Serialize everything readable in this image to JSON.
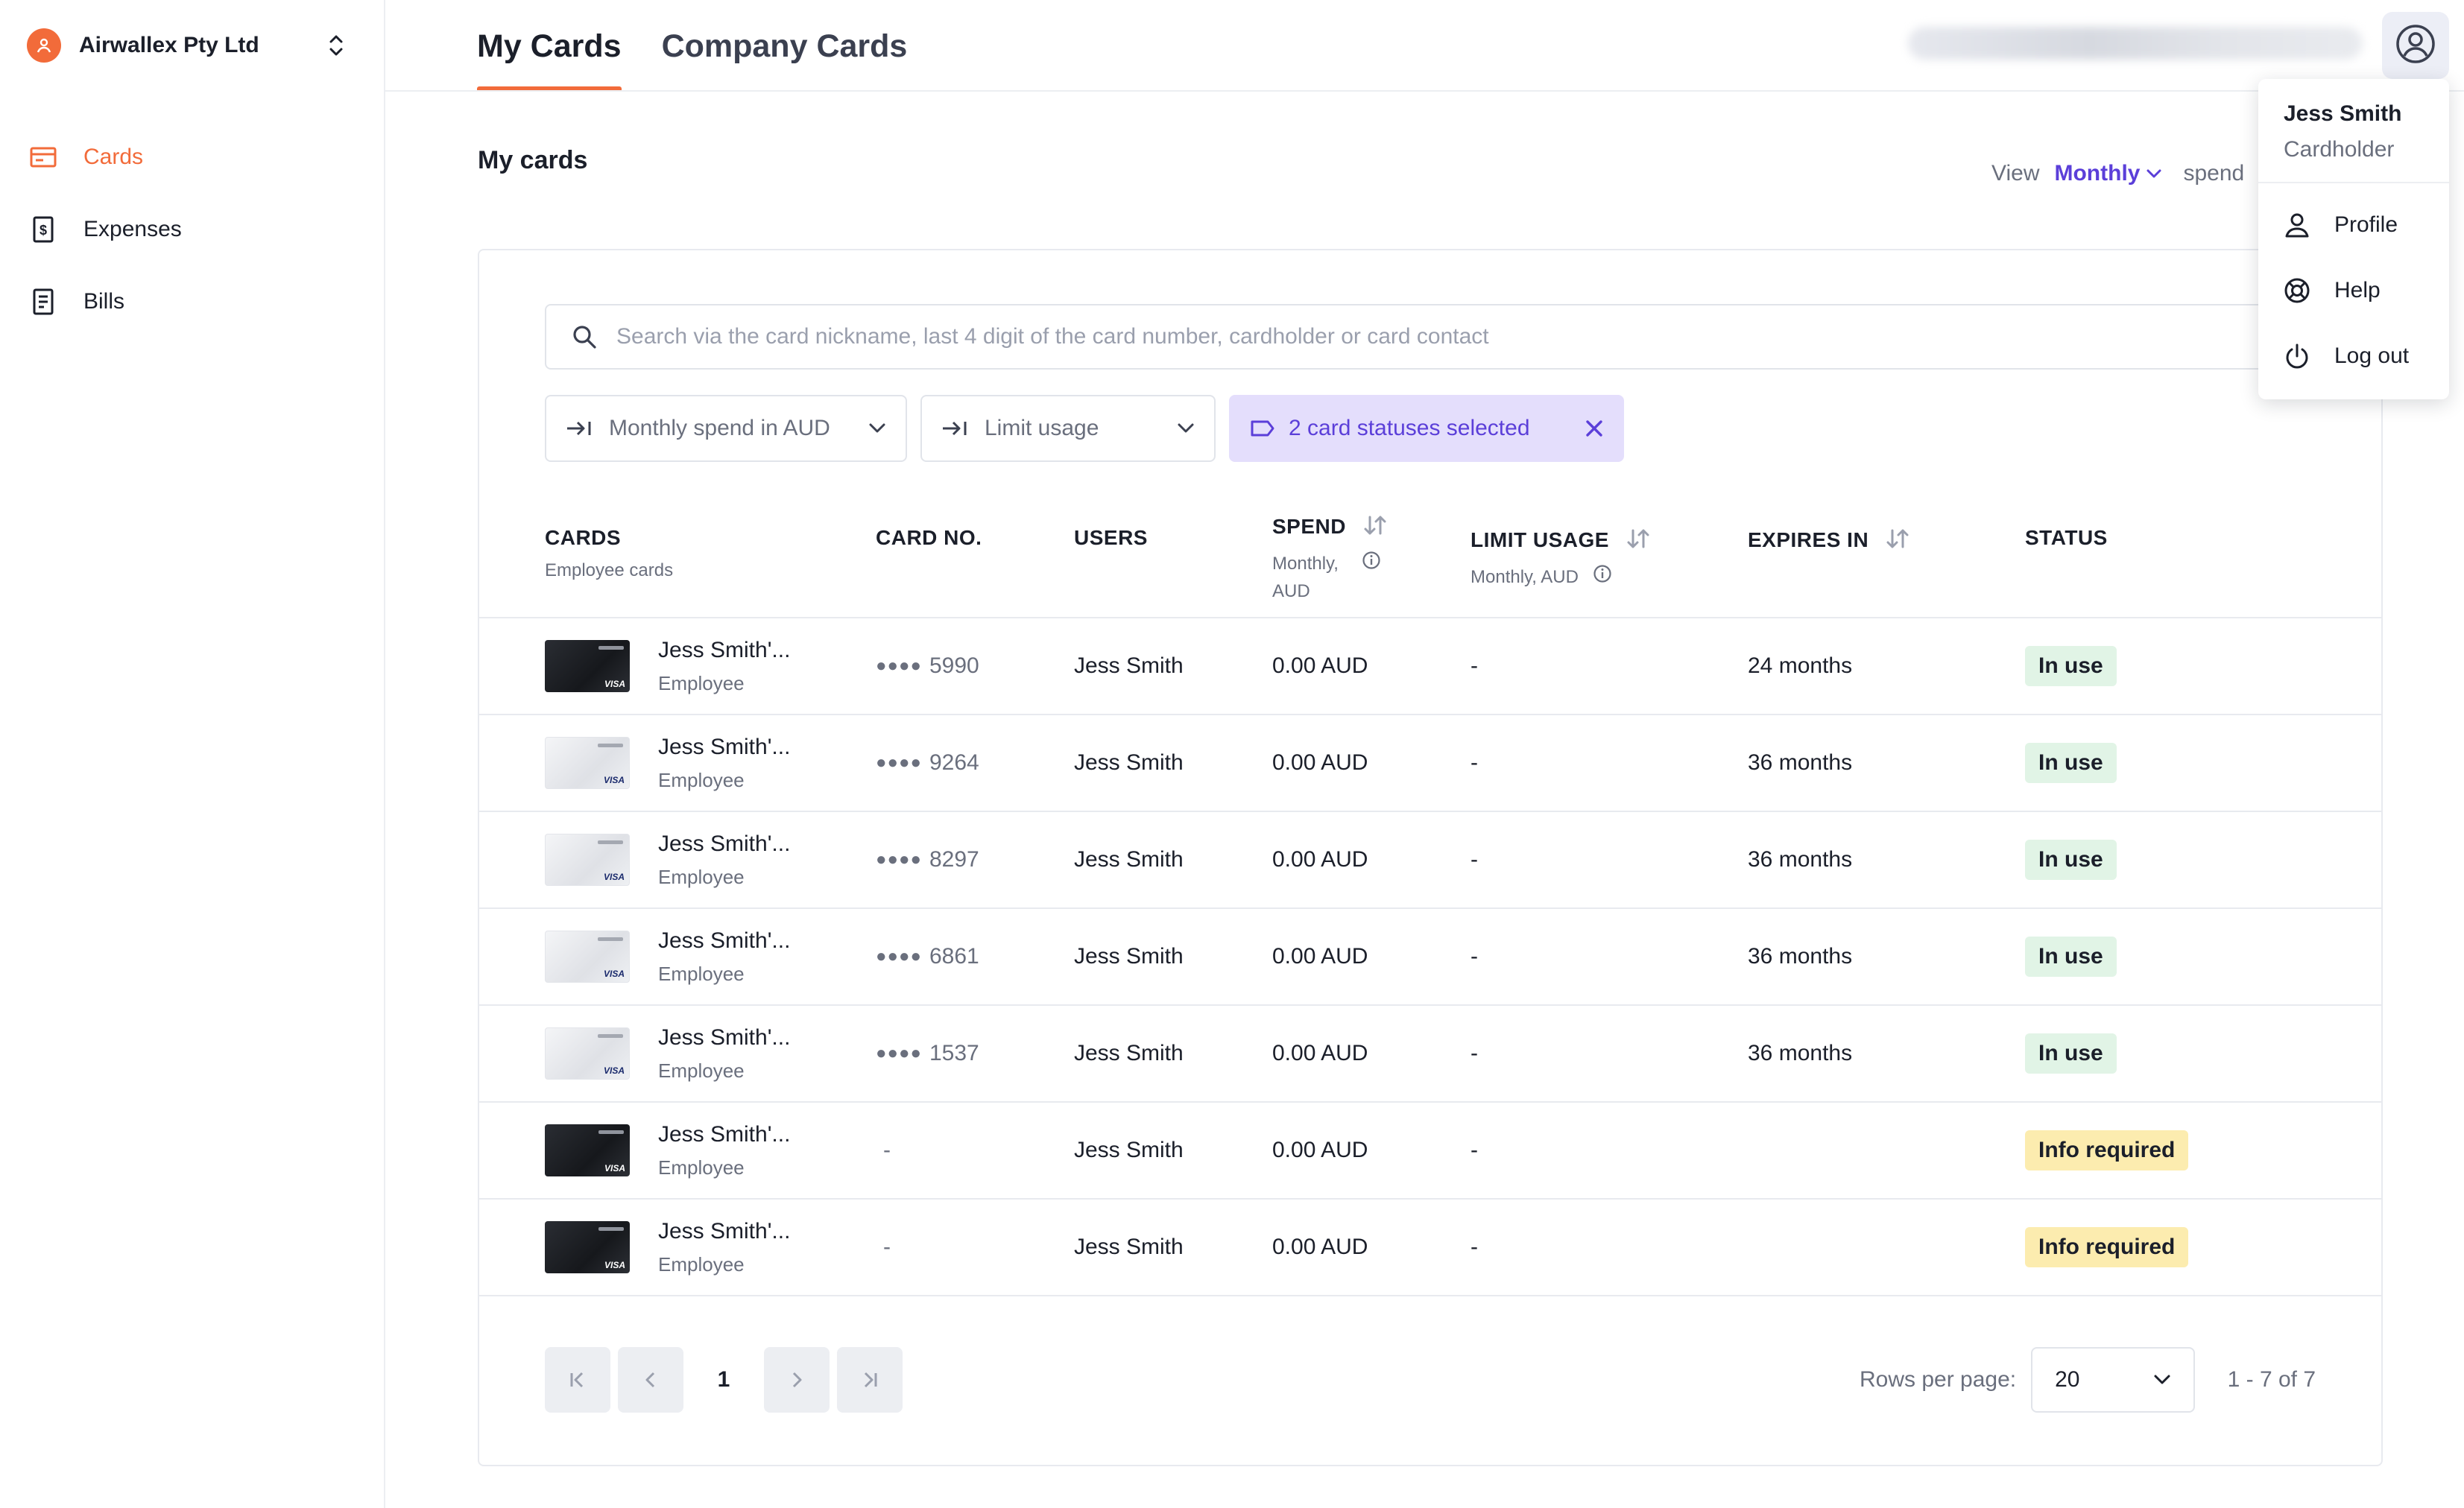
{
  "org": {
    "name": "Airwallex Pty Ltd"
  },
  "sidebar": {
    "items": [
      {
        "label": "Cards",
        "icon": "card-icon",
        "active": true
      },
      {
        "label": "Expenses",
        "icon": "receipt-icon",
        "active": false
      },
      {
        "label": "Bills",
        "icon": "document-icon",
        "active": false
      }
    ]
  },
  "tabs": [
    {
      "label": "My Cards",
      "active": true
    },
    {
      "label": "Company Cards",
      "active": false
    }
  ],
  "section": {
    "title": "My cards",
    "view_label": "View",
    "view_value": "Monthly",
    "view_suffix": "spend"
  },
  "search": {
    "placeholder": "Search via the card nickname, last 4 digit of the card number, cardholder or card contact",
    "value": ""
  },
  "filters": {
    "spend": "Monthly spend in AUD",
    "limit": "Limit usage",
    "status": "2 card statuses selected"
  },
  "table": {
    "headers": {
      "cards": "CARDS",
      "cards_sub": "Employee cards",
      "card_no": "CARD NO.",
      "users": "USERS",
      "spend": "SPEND",
      "spend_sub1": "Monthly,",
      "spend_sub2": "AUD",
      "limit": "LIMIT USAGE",
      "limit_sub": "Monthly, AUD",
      "expires": "EXPIRES IN",
      "status": "STATUS"
    },
    "rows": [
      {
        "name": "Jess Smith'...",
        "role": "Employee",
        "card_style": "dark",
        "card_no_mask": "●●●●",
        "card_no_last4": "5990",
        "user": "Jess Smith",
        "spend": "0.00 AUD",
        "limit": "-",
        "expires": "24 months",
        "status": "In use",
        "status_type": "inuse"
      },
      {
        "name": "Jess Smith'...",
        "role": "Employee",
        "card_style": "light",
        "card_no_mask": "●●●●",
        "card_no_last4": "9264",
        "user": "Jess Smith",
        "spend": "0.00 AUD",
        "limit": "-",
        "expires": "36 months",
        "status": "In use",
        "status_type": "inuse"
      },
      {
        "name": "Jess Smith'...",
        "role": "Employee",
        "card_style": "light",
        "card_no_mask": "●●●●",
        "card_no_last4": "8297",
        "user": "Jess Smith",
        "spend": "0.00 AUD",
        "limit": "-",
        "expires": "36 months",
        "status": "In use",
        "status_type": "inuse"
      },
      {
        "name": "Jess Smith'...",
        "role": "Employee",
        "card_style": "light",
        "card_no_mask": "●●●●",
        "card_no_last4": "6861",
        "user": "Jess Smith",
        "spend": "0.00 AUD",
        "limit": "-",
        "expires": "36 months",
        "status": "In use",
        "status_type": "inuse"
      },
      {
        "name": "Jess Smith'...",
        "role": "Employee",
        "card_style": "light",
        "card_no_mask": "●●●●",
        "card_no_last4": "1537",
        "user": "Jess Smith",
        "spend": "0.00 AUD",
        "limit": "-",
        "expires": "36 months",
        "status": "In use",
        "status_type": "inuse"
      },
      {
        "name": "Jess Smith'...",
        "role": "Employee",
        "card_style": "dark",
        "card_no_mask": "",
        "card_no_last4": "-",
        "user": "Jess Smith",
        "spend": "0.00 AUD",
        "limit": "-",
        "expires": "",
        "status": "Info required",
        "status_type": "info"
      },
      {
        "name": "Jess Smith'...",
        "role": "Employee",
        "card_style": "dark",
        "card_no_mask": "",
        "card_no_last4": "-",
        "user": "Jess Smith",
        "spend": "0.00 AUD",
        "limit": "-",
        "expires": "",
        "status": "Info required",
        "status_type": "info"
      }
    ]
  },
  "pagination": {
    "current_page": "1",
    "rows_per_page_label": "Rows per page:",
    "rows_per_page": "20",
    "range": "1 - 7 of 7"
  },
  "user_menu": {
    "name": "Jess Smith",
    "role": "Cardholder",
    "items": [
      {
        "label": "Profile",
        "icon": "person-icon"
      },
      {
        "label": "Help",
        "icon": "lifebuoy-icon"
      },
      {
        "label": "Log out",
        "icon": "power-icon"
      }
    ]
  },
  "colors": {
    "accent": "#f26b3a",
    "primary": "#5b3fd9",
    "in_use_bg": "#e1f4e6",
    "info_required_bg": "#fcecaf"
  }
}
